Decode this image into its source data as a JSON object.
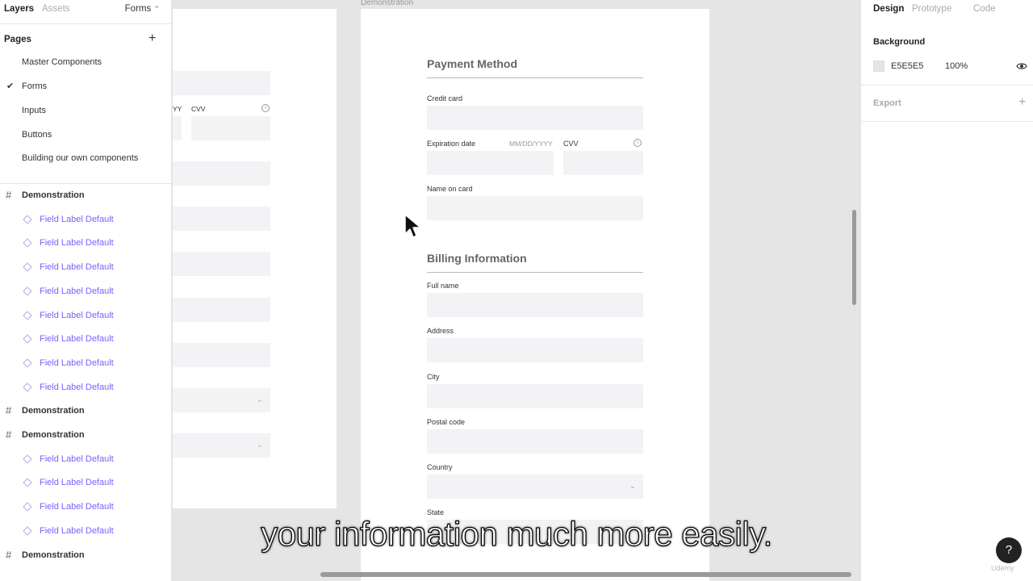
{
  "left_panel": {
    "tabs": {
      "layers": "Layers",
      "assets": "Assets"
    },
    "page_selector": "Forms",
    "pages_title": "Pages",
    "pages": [
      {
        "label": "Master Components",
        "current": false
      },
      {
        "label": "Forms",
        "current": true
      },
      {
        "label": "Inputs",
        "current": false
      },
      {
        "label": "Buttons",
        "current": false
      },
      {
        "label": "Building our own components",
        "current": false
      }
    ],
    "layers": [
      {
        "type": "frame",
        "label": "Demonstration"
      },
      {
        "type": "component",
        "label": "Field Label Default"
      },
      {
        "type": "component",
        "label": "Field Label Default"
      },
      {
        "type": "component",
        "label": "Field Label Default"
      },
      {
        "type": "component",
        "label": "Field Label Default"
      },
      {
        "type": "component",
        "label": "Field Label Default"
      },
      {
        "type": "component",
        "label": "Field Label Default"
      },
      {
        "type": "component",
        "label": "Field Label Default"
      },
      {
        "type": "component",
        "label": "Field Label Default"
      },
      {
        "type": "frame",
        "label": "Demonstration"
      },
      {
        "type": "frame",
        "label": "Demonstration"
      },
      {
        "type": "component",
        "label": "Field Label Default"
      },
      {
        "type": "component",
        "label": "Field Label Default"
      },
      {
        "type": "component",
        "label": "Field Label Default"
      },
      {
        "type": "component",
        "label": "Field Label Default"
      },
      {
        "type": "frame",
        "label": "Demonstration"
      }
    ]
  },
  "canvas": {
    "frame_name": "Demonstration",
    "ghost_labels": {
      "date_hint": "YY",
      "cvv": "CVV"
    },
    "payment": {
      "title": "Payment Method",
      "credit_card": "Credit card",
      "expiration": "Expiration date",
      "expiration_hint": "MM/DD/YYYY",
      "cvv": "CVV",
      "name_on_card": "Name on card"
    },
    "billing": {
      "title": "Billing Information",
      "full_name": "Full name",
      "address": "Address",
      "city": "City",
      "postal_code": "Postal code",
      "country": "Country",
      "state": "State"
    }
  },
  "right_panel": {
    "tabs": {
      "design": "Design",
      "prototype": "Prototype",
      "code": "Code"
    },
    "background_title": "Background",
    "background_hex": "E5E5E5",
    "background_opacity": "100%",
    "background_color": "#e5e5e5",
    "export_label": "Export"
  },
  "help_label": "?",
  "watermark": "Udemy",
  "caption": "your information much more easily."
}
